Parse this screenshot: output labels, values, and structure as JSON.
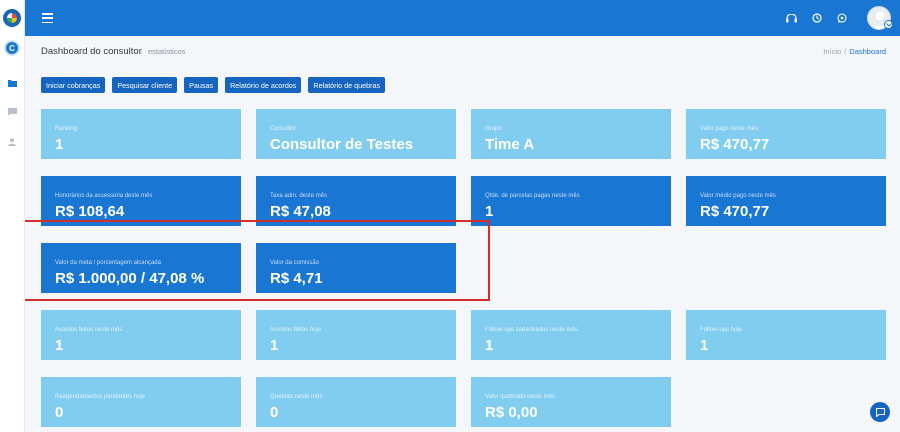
{
  "header": {
    "title": "Dashboard do consultor",
    "subtitle": "estatísticos"
  },
  "sidebar": {
    "avatar_initial": "C",
    "icons": [
      "folder-icon",
      "message-icon",
      "user-icon"
    ]
  },
  "topbar": {
    "icons": [
      "menu-icon",
      "headset-icon",
      "clock-icon",
      "whatsapp-icon",
      "avatar"
    ]
  },
  "breadcrumb": {
    "home": "Início",
    "separator": "/",
    "current": "Dashboard"
  },
  "actions": [
    "Iniciar cobranças",
    "Pesquisar cliente",
    "Pausas",
    "Relatório de acordos",
    "Relatório de quebras"
  ],
  "cards": [
    {
      "label": "Ranking",
      "value": "1",
      "style": "light"
    },
    {
      "label": "Consultor",
      "value": "Consultor de Testes",
      "style": "light"
    },
    {
      "label": "Grupo",
      "value": "Time A",
      "style": "light"
    },
    {
      "label": "Valor pago neste mês",
      "value": "R$ 470,77",
      "style": "light"
    },
    {
      "label": "Honorários da assessoria deste mês",
      "value": "R$ 108,64",
      "style": "dark"
    },
    {
      "label": "Taxa adm. deste mês",
      "value": "R$ 47,08",
      "style": "dark"
    },
    {
      "label": "Qtde. de parcelas pagas neste mês",
      "value": "1",
      "style": "dark"
    },
    {
      "label": "Valor médio pago neste mês",
      "value": "R$ 470,77",
      "style": "dark"
    },
    {
      "label": "Valor da meta / porcentagem alcançada",
      "value": "R$ 1.000,00 / 47,08 %",
      "style": "dark"
    },
    {
      "label": "Valor da comissão",
      "value": "R$ 4,71",
      "style": "dark"
    },
    {
      "label": "Acordos feitos neste mês",
      "value": "1",
      "style": "light"
    },
    {
      "label": "Acordos feitos hoje",
      "value": "1",
      "style": "light"
    },
    {
      "label": "Follow-ups cadastrados neste mês",
      "value": "1",
      "style": "light"
    },
    {
      "label": "Follow-ups hoje",
      "value": "1",
      "style": "light"
    },
    {
      "label": "Reagendamentos pendentes hoje",
      "value": "0",
      "style": "light"
    },
    {
      "label": "Quebras neste mês",
      "value": "0",
      "style": "light"
    },
    {
      "label": "Valor quebrado neste mês",
      "value": "R$ 0,00",
      "style": "light"
    }
  ],
  "colors": {
    "primary": "#1976d2",
    "light_card": "#81cdf0",
    "dark_card": "#1976d2",
    "highlight": "#d32f2f"
  }
}
